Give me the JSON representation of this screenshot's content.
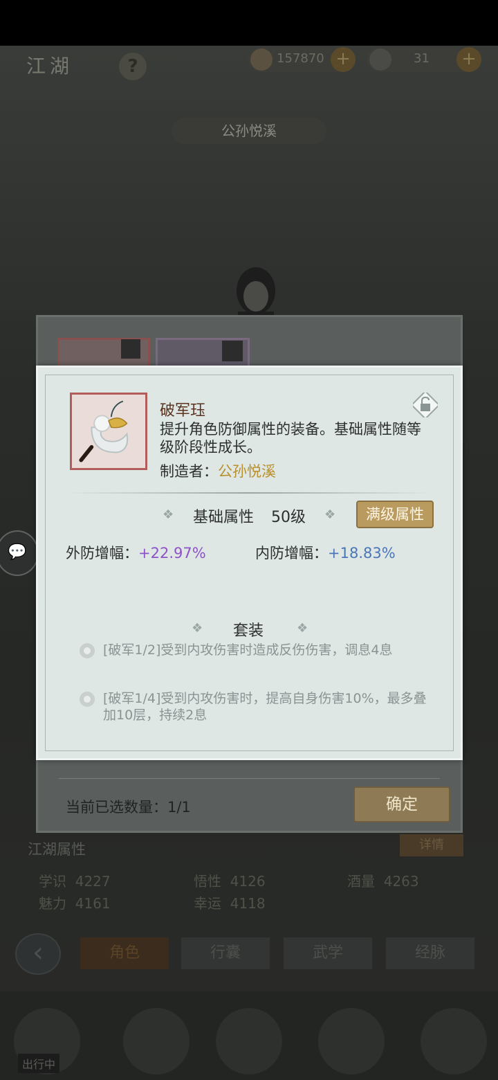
{
  "topbar": {
    "area_title": "江湖",
    "help": "?",
    "coins": "157870",
    "silver": "31",
    "plus": "+"
  },
  "character": {
    "name": "公孙悦溪"
  },
  "item": {
    "name": "破军珏",
    "description": "提升角色防御属性的装备。基础属性随等级阶段性成长。",
    "maker_label": "制造者：",
    "maker_name": "公孙悦溪",
    "base_attr_label": "基础属性",
    "level": "50级",
    "max_level_button": "满级属性",
    "attrs": [
      {
        "label": "外防增幅：",
        "value": "+22.97%"
      },
      {
        "label": "内防增幅：",
        "value": "+18.83%"
      }
    ],
    "set_title": "套装",
    "set_effects": [
      "[破军1/2]受到内攻伤害时造成反伤伤害，调息4息",
      "[破军1/4]受到内攻伤害时，提高自身伤害10%，最多叠加10层，持续2息"
    ]
  },
  "selection": {
    "count_label": "当前已选数量：1/1",
    "confirm": "确定"
  },
  "stats": {
    "title": "江湖属性",
    "details": "详情",
    "items": [
      {
        "label": "学识",
        "value": "4227"
      },
      {
        "label": "悟性",
        "value": "4126"
      },
      {
        "label": "酒量",
        "value": "4263"
      },
      {
        "label": "魅力",
        "value": "4161"
      },
      {
        "label": "幸运",
        "value": "4118"
      }
    ]
  },
  "tabs": [
    "角色",
    "行囊",
    "武学",
    "经脉"
  ],
  "nav": {
    "label": "出行中"
  },
  "colors": {
    "accent_gold": "#b99a5f",
    "attr_purple": "#8c52c6",
    "attr_blue": "#4a76b8"
  }
}
